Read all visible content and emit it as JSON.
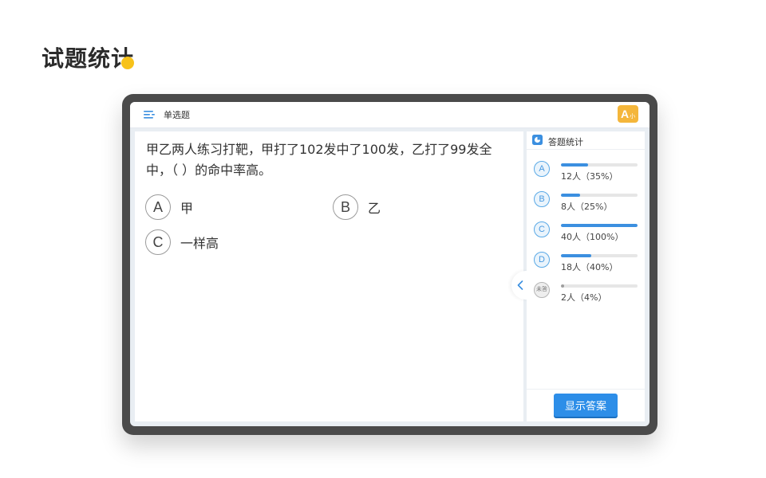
{
  "page": {
    "title": "试题统计"
  },
  "topbar": {
    "title": "单选题",
    "font_size_button": "A",
    "font_size_sub": "小"
  },
  "question": {
    "text": "甲乙两人练习打靶，甲打了102发中了100发，乙打了99发全中，（ ）的命中率高。",
    "options": [
      {
        "letter": "A",
        "text": "甲"
      },
      {
        "letter": "B",
        "text": "乙"
      },
      {
        "letter": "C",
        "text": "一样高"
      }
    ]
  },
  "stats": {
    "title": "答题统计",
    "rows": [
      {
        "label": "A",
        "text": "12人（35%）",
        "percent": 35
      },
      {
        "label": "B",
        "text": "8人（25%）",
        "percent": 25
      },
      {
        "label": "C",
        "text": "40人（100%）",
        "percent": 100
      },
      {
        "label": "D",
        "text": "18人（40%）",
        "percent": 40
      },
      {
        "label": "未答",
        "text": "2人（4%）",
        "percent": 4
      }
    ],
    "show_answer_label": "显示答案"
  },
  "colors": {
    "accent": "#2d8ee8",
    "bar_answered": "#3b8fe0",
    "bar_unanswered": "#9e9e9e",
    "title_dot": "#f7c21a",
    "font_button": "#f4b63b"
  },
  "icons": {
    "menu": "list-icon",
    "stats": "pie-chart-icon",
    "collapse": "chevron-left-icon"
  }
}
